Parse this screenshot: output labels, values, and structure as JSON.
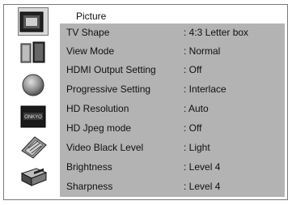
{
  "menu": {
    "header_title": "Picture",
    "sidebar": [
      {
        "icon": "tv-display-icon",
        "selected": true
      },
      {
        "icon": "speakers-icon",
        "selected": false
      },
      {
        "icon": "disc-icon",
        "selected": false
      },
      {
        "icon": "onkyo-device-icon",
        "selected": false,
        "logo_text": "ONKYO"
      },
      {
        "icon": "keyboard-icon",
        "selected": false
      },
      {
        "icon": "player-unit-icon",
        "selected": false
      }
    ],
    "rows": [
      {
        "label": "TV Shape",
        "value": ": 4:3 Letter box"
      },
      {
        "label": "View Mode",
        "value": ": Normal"
      },
      {
        "label": "HDMI Output Setting",
        "value": ": Off"
      },
      {
        "label": "Progressive Setting",
        "value": ": Interlace"
      },
      {
        "label": "HD Resolution",
        "value": ": Auto"
      },
      {
        "label": "HD Jpeg mode",
        "value": ": Off"
      },
      {
        "label": "Video Black Level",
        "value": ": Light"
      },
      {
        "label": "Brightness",
        "value": ": Level 4"
      },
      {
        "label": "Sharpness",
        "value": ": Level 4"
      }
    ]
  }
}
